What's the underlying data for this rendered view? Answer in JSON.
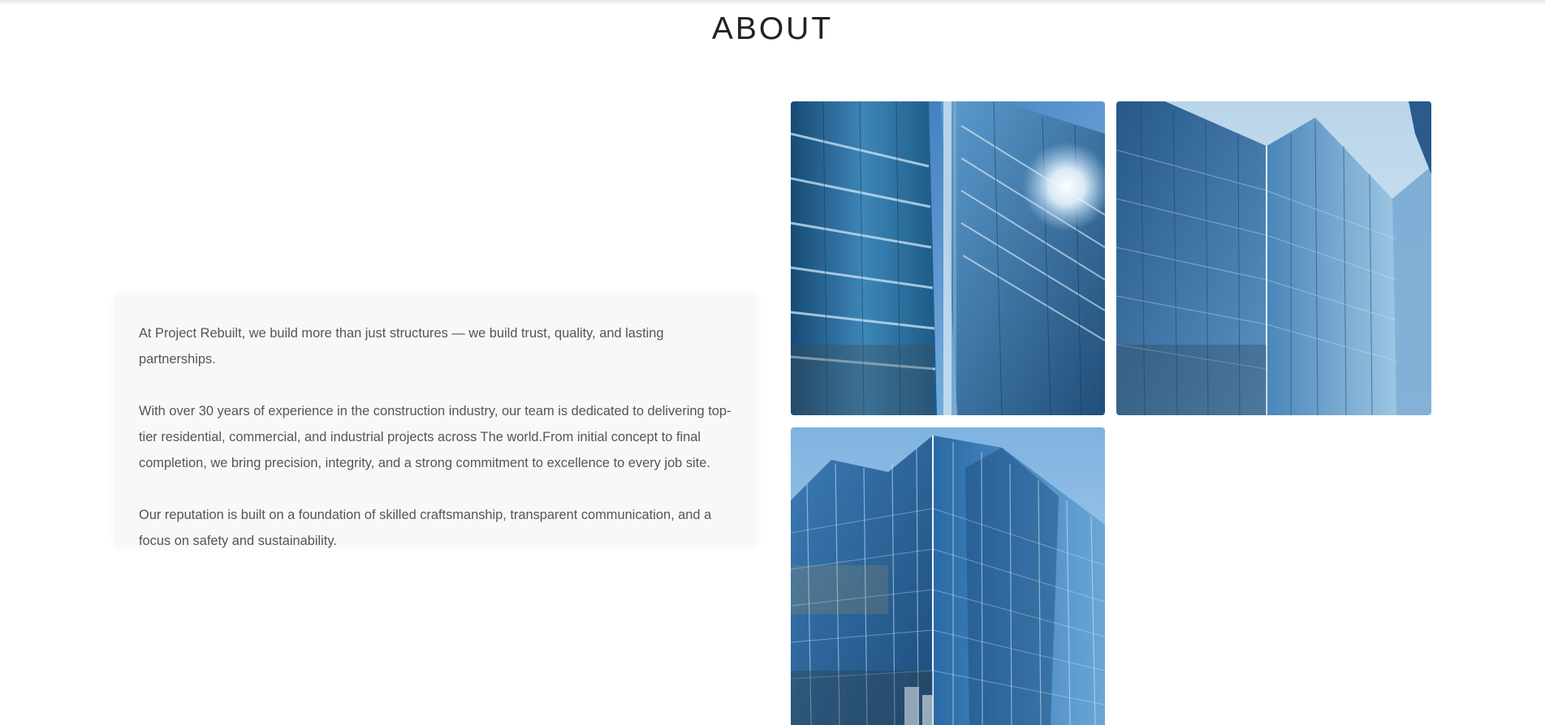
{
  "section": {
    "title": "ABOUT"
  },
  "about_text": {
    "paragraph_1": "At Project Rebuilt, we build more than just structures — we build trust, quality, and lasting partnerships.",
    "paragraph_2": "With over 30 years of experience in the construction industry, our team is dedicated to delivering top-tier residential, commercial, and industrial projects across The world.From initial concept to final completion, we bring precision, integrity, and a strong commitment to excellence to every job site.",
    "paragraph_3": "Our reputation is built on a foundation of skilled craftsmanship, transparent communication, and a focus on safety and sustainability."
  },
  "gallery": {
    "images": [
      {
        "subject": "glass-skyscraper-photo"
      },
      {
        "subject": "glass-skyscraper-photo"
      },
      {
        "subject": "glass-skyscraper-photo"
      }
    ]
  },
  "colors": {
    "card_background": "#f8f8f8",
    "body_text": "#555555",
    "title_text": "#222222",
    "glass_blue": "#2f6ea8"
  }
}
